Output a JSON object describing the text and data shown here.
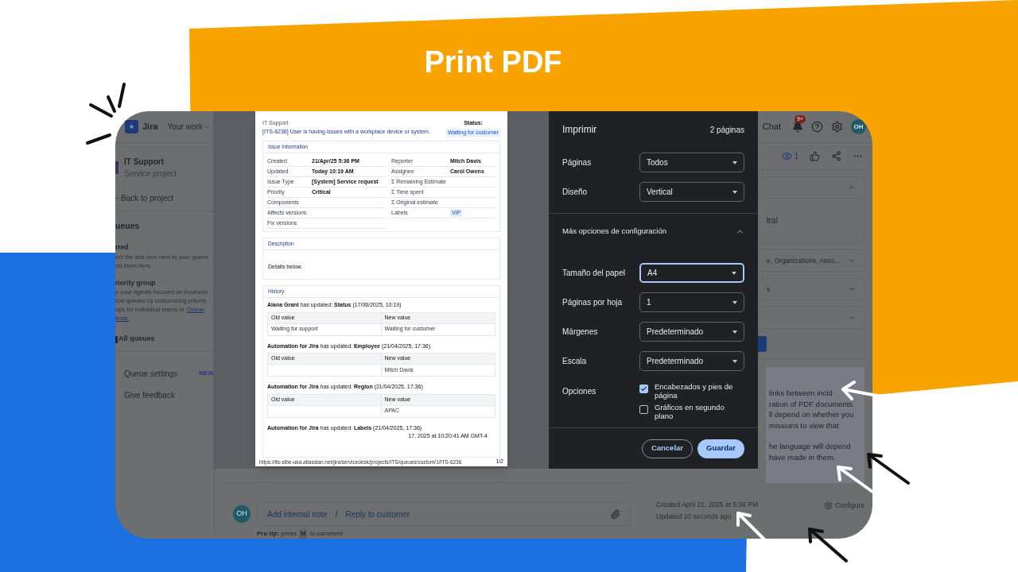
{
  "title": "Print PDF",
  "jira": {
    "topbar": {
      "product": "Jira",
      "nav": "Your work",
      "chat": "Chat",
      "notifications": "9+",
      "avatar": "OH"
    },
    "sidebar": {
      "project": "IT Support",
      "project_type": "Service project",
      "back": "Back to project",
      "heading": "ueues",
      "starred_title": "rred",
      "starred_lines": [
        {
          "text": "ect the star icon next to your queue"
        },
        {
          "text": "dd them here."
        }
      ],
      "priority_title": "riority group",
      "priority_lines": [
        {
          "text": "p your agents focused on business"
        },
        {
          "text": "ical queues by customizing priority"
        },
        {
          "text": "ups for individual teams in",
          "link": "Queue"
        },
        {
          "link": "tings."
        }
      ],
      "all_queues": "All queues",
      "items": [
        {
          "label": "Queue settings",
          "badge": "NEW"
        },
        {
          "label": "Give feedback"
        }
      ]
    },
    "watchers": "1",
    "panels": [
      {
        "text": "tral",
        "expanded": true
      },
      {
        "text": "e, Organizations, Asso...",
        "expanded": false
      },
      {
        "text": "s",
        "expanded": false
      },
      {
        "expanded": true
      }
    ],
    "info_paragraphs": [
      [
        "links between incid",
        "ration of PDF documents.",
        "ll depend on whether you",
        "missions to view that"
      ],
      [
        "he language will depend",
        "have made in them."
      ]
    ],
    "created": "Created April 21, 2025 at 5:36 PM",
    "updated": "Updated 10 seconds ago",
    "configure": "Configure",
    "comment": {
      "avatar": "OH",
      "internal": "Add internal note",
      "separator": "/",
      "reply": "Reply to customer"
    },
    "pro_tip": {
      "prefix": "**Pro tip:** press",
      "key": "M",
      "suffix": "to comment"
    }
  },
  "preview": {
    "breadcrumb": "IT Support",
    "issue_title": "[ITS-6236] User is having issues with a workplace device or system.",
    "status_label": "Status:",
    "status": "Waiting for customer",
    "info_title": "Issue Information",
    "left_fields": [
      {
        "label": "Created",
        "value": "21/Apr/25 5:36 PM"
      },
      {
        "label": "Updated",
        "value": "Today 10:19 AM"
      },
      {
        "label": "Issue Type",
        "value": "[System] Service request"
      },
      {
        "label": "Priority",
        "value": "Critical"
      },
      {
        "label": "Components"
      },
      {
        "label": "Affects versions"
      },
      {
        "label": "Fix versions"
      }
    ],
    "right_fields": [
      {
        "label": "Reporter",
        "value": "Mitch Davis"
      },
      {
        "label": "Assignee",
        "value": "Carol Owens"
      },
      {
        "label": "Σ Remaining Estimate"
      },
      {
        "label": "Σ Time spent"
      },
      {
        "label": "Σ Original estimate"
      },
      {
        "label": "Labels",
        "tag": "VIP"
      }
    ],
    "description_title": "Description",
    "description": "Details below.",
    "history_title": "History",
    "history": [
      {
        "heading": "**Alana Grant** has updated: **Status** (17/06/2025, 10:19)",
        "old_header": "Old value",
        "new_header": "New value",
        "old": "Waiting for support",
        "new": "Waiting for customer"
      },
      {
        "heading": "**Automation for Jira** has updated: **Employee** (21/04/2025, 17:36)",
        "old_header": "Old value",
        "new_header": "New value",
        "new": "Mitch Davis"
      },
      {
        "heading": "**Automation for Jira** has updated: **Region** (21/04/2025, 17:36)",
        "old_header": "Old value",
        "new_header": "New value",
        "new": "APAC"
      }
    ],
    "last_heading": "**Automation for Jira** has updated: **Labels** (21/04/2025, 17:36)",
    "footer_date": "17, 2025 at 10:20:41 AM GMT-4",
    "footer_url": "https://its-stbe-uka.atlassian.net/jira/servicedesk/projects/ITS/queues/custom/1/ITS-6236",
    "footer_page": "1/2"
  },
  "print_dialog": {
    "title": "Imprimir",
    "pages": "2 páginas",
    "settings": [
      {
        "kind": "select",
        "label": "Páginas",
        "value": "Todos",
        "focused": false
      },
      {
        "kind": "select",
        "label": "Diseño",
        "value": "Vertical",
        "focused": false
      }
    ],
    "more": {
      "label": "Más opciones de configuración",
      "expanded": true
    },
    "more_settings": [
      {
        "kind": "select",
        "label": "Tamaño del papel",
        "value": "A4",
        "focused": true
      },
      {
        "kind": "select",
        "label": "Páginas por hoja",
        "value": "1",
        "focused": false
      },
      {
        "kind": "select",
        "label": "Márgenes",
        "value": "Predeterminado",
        "focused": false
      },
      {
        "kind": "select",
        "label": "Escala",
        "value": "Predeterminado",
        "focused": false
      },
      {
        "kind": "checkboxes",
        "label": "Opciones",
        "options": [
          {
            "label": "Encabezados y pies de página",
            "checked": true
          },
          {
            "label": "Gráficos en segundo plano",
            "checked": false
          }
        ]
      }
    ],
    "buttons": [
      {
        "label": "Cancelar",
        "kind": "secondary"
      },
      {
        "label": "Guardar",
        "kind": "primary"
      }
    ]
  }
}
